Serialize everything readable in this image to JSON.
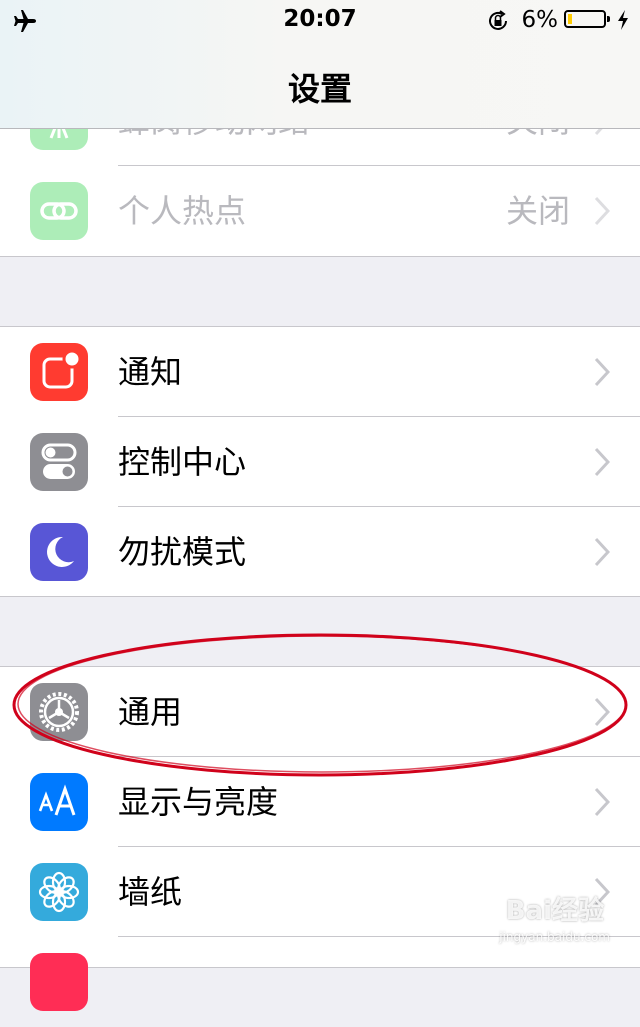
{
  "status_bar": {
    "time": "20:07",
    "battery_percent": "6%"
  },
  "nav": {
    "title": "设置"
  },
  "rows": {
    "cellular": {
      "label": "蜂窝移动网络",
      "value": "关闭"
    },
    "hotspot": {
      "label": "个人热点",
      "value": "关闭"
    },
    "notifications": {
      "label": "通知"
    },
    "control_center": {
      "label": "控制中心"
    },
    "do_not_disturb": {
      "label": "勿扰模式"
    },
    "general": {
      "label": "通用"
    },
    "display": {
      "label": "显示与亮度"
    },
    "wallpaper": {
      "label": "墙纸"
    }
  },
  "icons": {
    "cellular": "antenna-icon",
    "hotspot": "hotspot-chain-icon",
    "notifications": "notification-icon",
    "control_center": "toggle-icon",
    "do_not_disturb": "moon-icon",
    "general": "gear-icon",
    "display": "text-size-icon",
    "wallpaper": "flower-icon"
  },
  "colors": {
    "cellular": "#4cd964",
    "hotspot": "#4cd964",
    "notifications": "#ff3b30",
    "control_center": "#8e8e93",
    "do_not_disturb": "#5856d6",
    "general": "#8e8e93",
    "display": "#007aff",
    "wallpaper": "#34aadc",
    "annotation": "#d0021b"
  },
  "watermark": {
    "brand": "Bai经验",
    "url": "jingyan.baidu.com"
  }
}
